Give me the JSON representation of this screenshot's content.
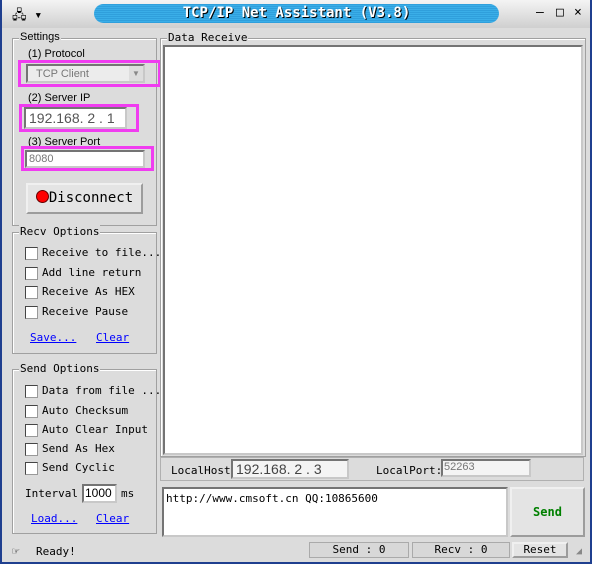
{
  "window": {
    "title": "TCP/IP Net Assistant (V3.8)"
  },
  "settings": {
    "label": "Settings",
    "protocol_label": "(1) Protocol",
    "protocol_value": "TCP Client",
    "server_ip_label": "(2) Server IP",
    "server_ip": "192.168. 2 . 1",
    "server_port_label": "(3) Server Port",
    "server_port": "8080",
    "disconnect_label": "Disconnect"
  },
  "recv_options": {
    "label": "Recv Options",
    "items": [
      "Receive to file...",
      "Add line return",
      "Receive As HEX",
      "Receive Pause"
    ],
    "save": "Save...",
    "clear": "Clear"
  },
  "send_options": {
    "label": "Send Options",
    "items": [
      "Data from file ...",
      "Auto Checksum",
      "Auto Clear Input",
      "Send As Hex",
      "Send Cyclic"
    ],
    "interval_label": "Interval",
    "interval_value": "1000",
    "interval_unit": "ms",
    "load": "Load...",
    "clear": "Clear"
  },
  "data_receive": {
    "label": "Data Receive"
  },
  "local": {
    "host_label": "LocalHost:",
    "host_value": "192.168. 2 . 3",
    "port_label": "LocalPort:",
    "port_value": "52263"
  },
  "send": {
    "text": "http://www.cmsoft.cn QQ:10865600",
    "button": "Send",
    "button_color": "#008000"
  },
  "status": {
    "text": "Ready!",
    "send_count": "Send : 0",
    "recv_count": "Recv : 0",
    "reset": "Reset"
  },
  "colors": {
    "highlight": "#f03cf0",
    "title_bar": "#3aaee8"
  }
}
